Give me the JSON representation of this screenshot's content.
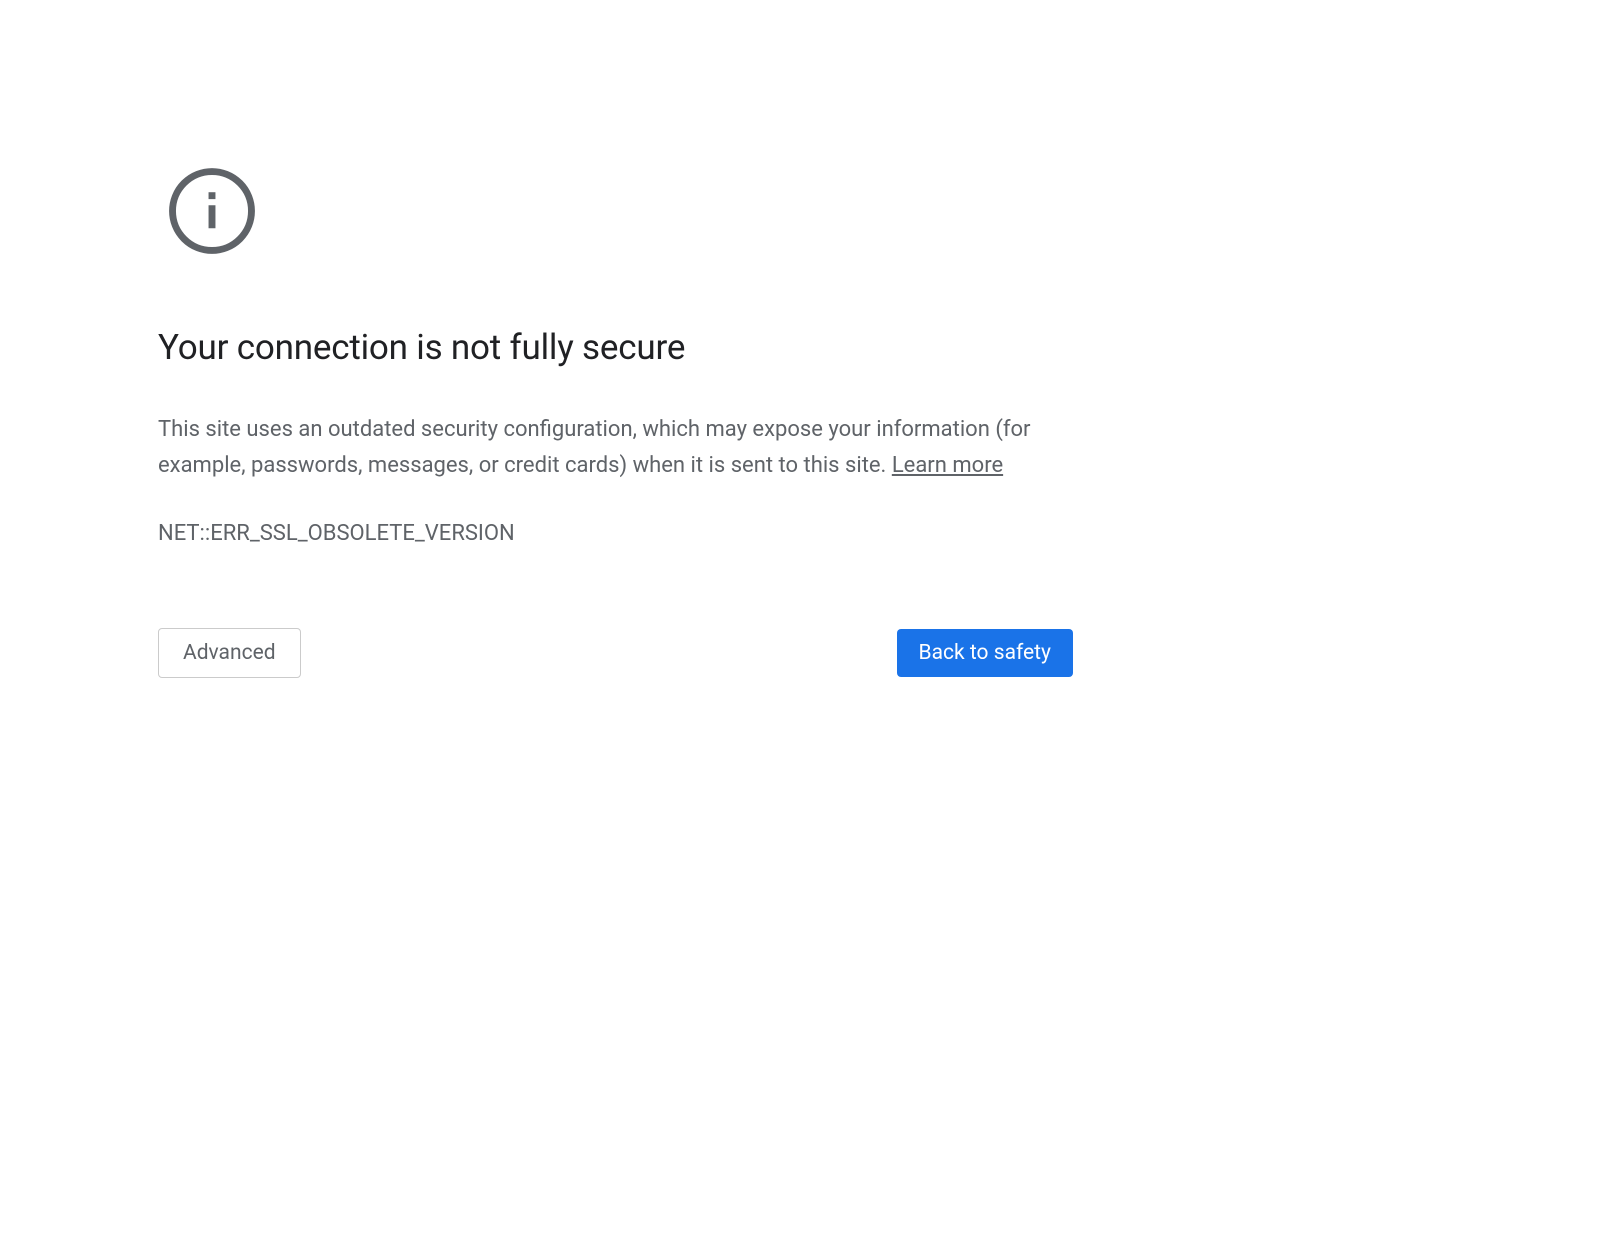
{
  "heading": "Your connection is not fully secure",
  "description": "This site uses an outdated security configuration, which may expose your information (for example, passwords, messages, or credit cards) when it is sent to this site. ",
  "learn_more": "Learn more",
  "error_code": "NET::ERR_SSL_OBSOLETE_VERSION",
  "buttons": {
    "advanced": "Advanced",
    "back_to_safety": "Back to safety"
  }
}
